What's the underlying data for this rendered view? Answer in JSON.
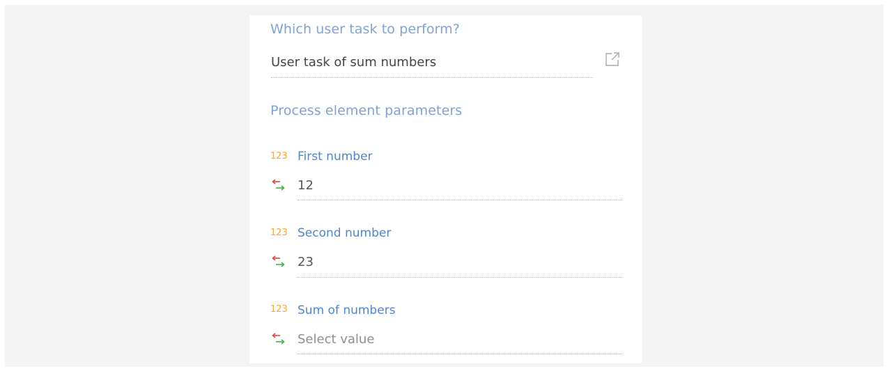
{
  "task_section": {
    "title": "Which user task to perform?",
    "selected_task": "User task of sum numbers",
    "open_icon": "external-link-icon"
  },
  "parameters_section": {
    "title": "Process element parameters",
    "items": [
      {
        "type_badge": "123",
        "label": "First number",
        "value": "12",
        "is_placeholder": false,
        "mapping_icon": "parameter-mapping-icon"
      },
      {
        "type_badge": "123",
        "label": "Second number",
        "value": "23",
        "is_placeholder": false,
        "mapping_icon": "parameter-mapping-icon"
      },
      {
        "type_badge": "123",
        "label": "Sum of numbers",
        "value": "Select value",
        "is_placeholder": true,
        "mapping_icon": "parameter-mapping-icon"
      }
    ]
  },
  "colors": {
    "section_title": "#7fa3ce",
    "param_label": "#4f86c9",
    "type_badge": "#f2a73d",
    "mapping_arrow_left": "#e0463c",
    "mapping_arrow_right": "#47b04b"
  }
}
